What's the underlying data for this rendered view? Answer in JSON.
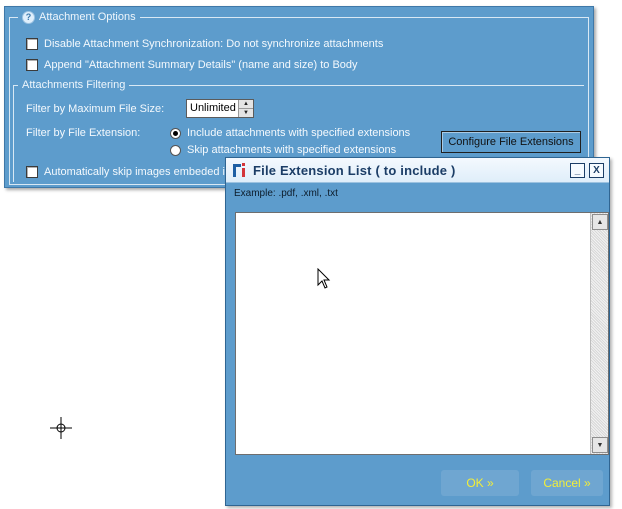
{
  "attachment_options": {
    "legend": "Attachment Options",
    "disable_sync": "Disable Attachment Synchronization: Do not synchronize attachments",
    "append_summary": "Append \"Attachment Summary Details\" (name and size) to Body",
    "filtering": {
      "legend": "Attachments Filtering",
      "max_size_label": "Filter by Maximum File Size:",
      "max_size_value": "Unlimited",
      "ext_label": "Filter by File Extension:",
      "include_option": "Include attachments with specified extensions",
      "skip_option": "Skip attachments with specified extensions",
      "configure_button": "Configure File Extensions",
      "selected": "include"
    },
    "auto_skip": "Automatically skip images embeded in"
  },
  "dialog": {
    "title": "File Extension List ( to include )",
    "example": "Example: .pdf, .xml, .txt",
    "list_value": "",
    "ok_label": "OK »",
    "cancel_label": "Cancel »",
    "minimize_icon": "_",
    "close_icon": "X"
  },
  "colors": {
    "panel": "#5d9ccc",
    "title_text": "#1b3d66",
    "button_text": "#f2ee3a"
  }
}
